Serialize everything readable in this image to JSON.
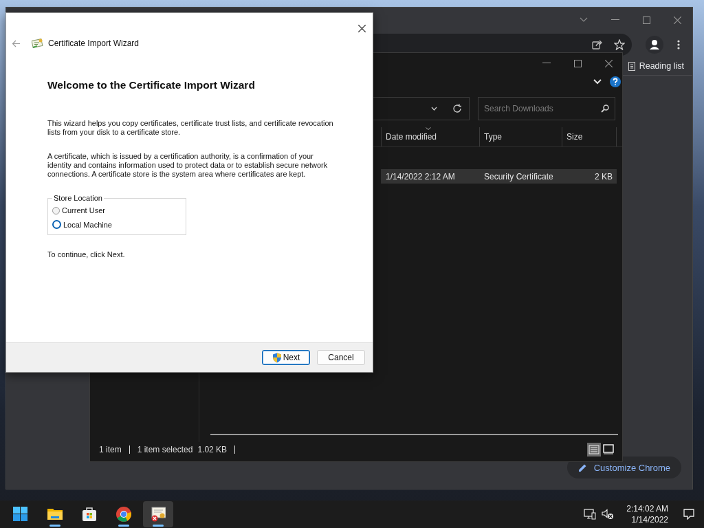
{
  "browser_window": {
    "toolbar_icons": [
      {
        "kind": "share"
      },
      {
        "kind": "star"
      },
      {
        "kind": "avatar"
      },
      {
        "kind": "menu"
      }
    ],
    "reading_list": "Reading list",
    "customize_button": "Customize Chrome"
  },
  "explorer_window": {
    "search": {
      "placeholder": "Search Downloads"
    },
    "table": {
      "columns": [
        "Date modified",
        "Type",
        "Size"
      ],
      "rows": [
        {
          "selected": true,
          "cells": [
            "1/14/2022 2:12 AM",
            "Security Certificate",
            "2 KB"
          ]
        }
      ]
    },
    "status_bar": {
      "count": "1 item",
      "selection": "1 item selected",
      "size": "1.02 KB"
    },
    "views": [
      {
        "kind": "details",
        "selected": true
      },
      {
        "kind": "tiles",
        "selected": false
      }
    ]
  },
  "dialog": {
    "title": "Certificate Import Wizard",
    "heading": "Welcome to the Certificate Import Wizard",
    "paragraphs": [
      "This wizard helps you copy certificates, certificate trust lists, and certificate revocation lists from your disk to a certificate store.",
      "A certificate, which is issued by a certification authority, is a confirmation of your identity and contains information used to protect data or to establish secure network connections. A certificate store is the system area where certificates are kept."
    ],
    "store_location": {
      "label": "Store Location",
      "options": [
        {
          "label": "Current User",
          "selected": false
        },
        {
          "label": "Local Machine",
          "selected": true
        }
      ]
    },
    "hint": "To continue, click Next.",
    "buttons": [
      {
        "label": "Next",
        "kind": "shield",
        "default": true
      },
      {
        "label": "Cancel",
        "kind": "plain",
        "default": false
      }
    ]
  },
  "taskbar": {
    "apps": [
      {
        "kind": "start",
        "running": false,
        "active": false
      },
      {
        "kind": "folder",
        "running": true,
        "active": false
      },
      {
        "kind": "store",
        "running": false,
        "active": false
      },
      {
        "kind": "chrome",
        "running": true,
        "active": false
      },
      {
        "kind": "certificate",
        "running": true,
        "active": true
      }
    ],
    "tray": [
      {
        "kind": "network"
      },
      {
        "kind": "muted"
      }
    ],
    "time": "2:14:02 AM",
    "date": "1/14/2022"
  }
}
